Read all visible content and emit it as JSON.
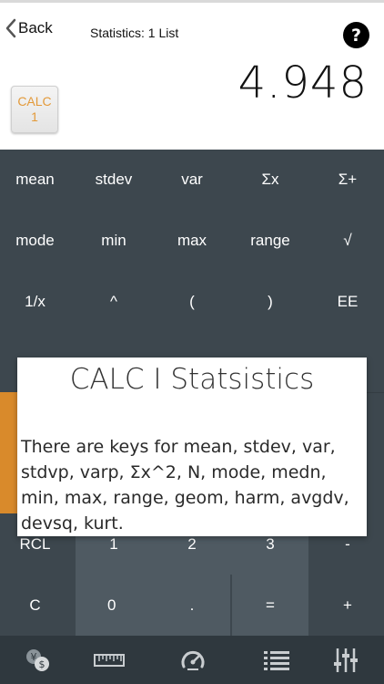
{
  "header": {
    "back_label": "Back",
    "title": "Statistics: 1 List",
    "help_label": "?"
  },
  "display": {
    "value": "4.948"
  },
  "calc_button": {
    "line1": "CALC",
    "line2": "1"
  },
  "keys": {
    "row1": [
      "mean",
      "stdev",
      "var",
      "Σx",
      "Σ+"
    ],
    "row2": [
      "mode",
      "min",
      "max",
      "range",
      "√"
    ],
    "row3": [
      "1/x",
      "^",
      "(",
      ")",
      "EE"
    ],
    "row6": [
      "RCL",
      "1",
      "2",
      "3",
      "-"
    ],
    "row7": [
      "C",
      "0",
      ".",
      "=",
      "+"
    ]
  },
  "popup": {
    "title": "CALC I Statsistics",
    "body": "There are keys for mean, stdev, var, stdvp, varp, Σx^2, N, mode, medn, min, max, range, geom, harm, avgdv, devsq, kurt."
  },
  "tabbar": {
    "icons": [
      "currency-icon",
      "ruler-icon",
      "speedometer-icon",
      "list-icon",
      "sliders-icon"
    ]
  },
  "colors": {
    "keypad_bg": "#3d474e",
    "key_light": "#4f5a62",
    "accent_orange": "#d98a2b",
    "calc_text": "#e39a3a",
    "tabbar_bg": "#2f383e"
  }
}
